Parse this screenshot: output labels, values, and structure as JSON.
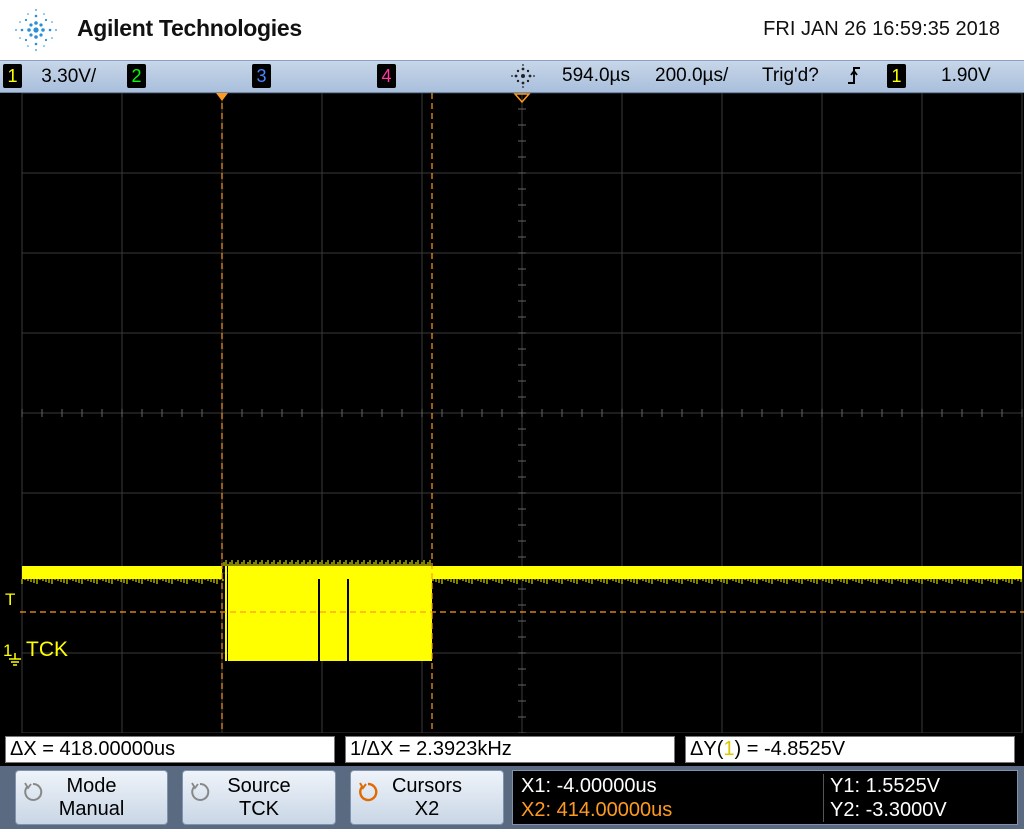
{
  "header": {
    "brand": "Agilent Technologies",
    "datetime": "FRI JAN 26 16:59:35 2018"
  },
  "status_bar": {
    "ch1": {
      "num": "1",
      "scale": "3.30V/",
      "color": "#ffff00"
    },
    "ch2": {
      "num": "2",
      "color": "#00ff00"
    },
    "ch3": {
      "num": "3",
      "color": "#4080ff"
    },
    "ch4": {
      "num": "4",
      "color": "#ff3090"
    },
    "delay": "594.0µs",
    "timebase": "200.0µs/",
    "trigger_status": "Trig'd?",
    "trigger_edge": "ʂ",
    "trigger_source": "1",
    "trigger_level": "1.90V"
  },
  "waveform": {
    "label": "TCK",
    "ground_marker": "1",
    "trigger_marker": "T",
    "color": "#ffff00"
  },
  "measurements": {
    "dx": "ΔX = 418.00000us",
    "inv_dx": "1/ΔX = 2.3923kHz",
    "dy_prefix": "ΔY(",
    "dy_channel": "1",
    "dy_suffix": ") = -4.8525V"
  },
  "softkeys": {
    "mode": {
      "label": "Mode",
      "value": "Manual"
    },
    "source": {
      "label": "Source",
      "value": "TCK"
    },
    "cursors": {
      "label": "Cursors",
      "value": "X2"
    }
  },
  "cursor_readout": {
    "x1": "X1: -4.00000us",
    "x2": "X2: 414.00000us",
    "y1": "Y1: 1.5525V",
    "y2": "Y2: -3.3000V"
  }
}
